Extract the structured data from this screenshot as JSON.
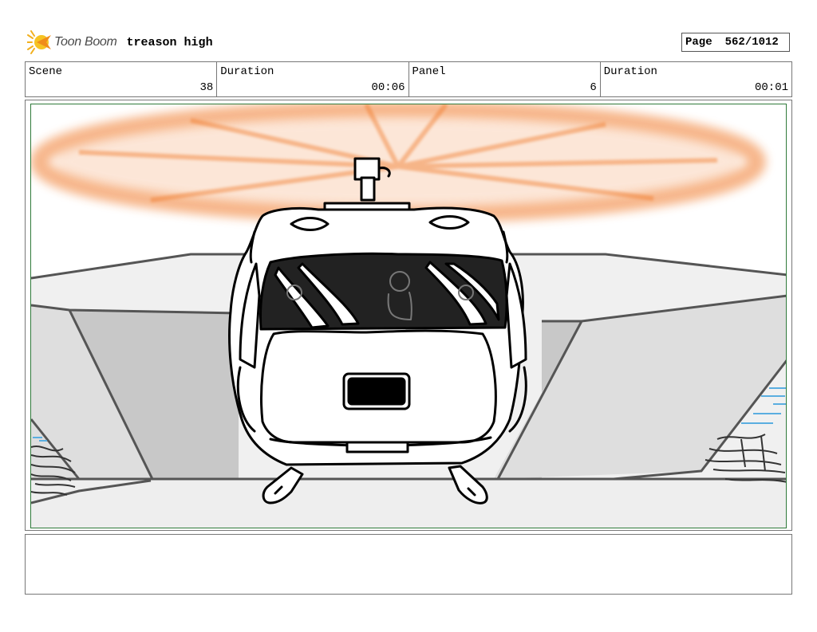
{
  "header": {
    "brand_name": "Toon Boom",
    "project_title": "treason high",
    "page_label": "Page",
    "page_value": "562/1012"
  },
  "info": {
    "scene_label": "Scene",
    "scene_value": "38",
    "scene_duration_label": "Duration",
    "scene_duration_value": "00:06",
    "panel_label": "Panel",
    "panel_value": "6",
    "panel_duration_label": "Duration",
    "panel_duration_value": "00:01"
  },
  "panel": {
    "illustration": "helicopter-front-view",
    "rotor_color": "#f07a2a",
    "frame_color": "#2f7a3a"
  },
  "notes": {
    "text": ""
  }
}
